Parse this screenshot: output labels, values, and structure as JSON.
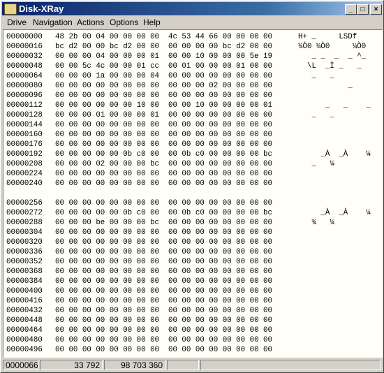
{
  "window": {
    "title": "Disk-XRay"
  },
  "menu": [
    "Drive",
    "Navigation",
    "Actions",
    "Options",
    "Help"
  ],
  "titlebar_buttons": [
    "minimize-icon",
    "maximize-icon",
    "close-icon"
  ],
  "dump": [
    {
      "offset": "00000000",
      "hex": "48 2b 00 04 00 00 00 00  4c 53 44 66 00 00 00 00",
      "ascii": "H+ _     LSDf"
    },
    {
      "offset": "00000016",
      "hex": "bc d2 00 00 bc d2 00 00  00 00 00 00 bc d2 00 00",
      "ascii": "¼Ò0 ¼Ò0     ¼Ò0"
    },
    {
      "offset": "00000032",
      "hex": "00 00 00 04 00 00 00 01  00 00 10 00 00 00 5e 19",
      "ascii": "   _ _  _  _ ^_"
    },
    {
      "offset": "00000048",
      "hex": "00 00 5c 4c 00 00 01 cc  00 01 00 00 00 01 00 00",
      "ascii": "  \\L  _Ì _   _"
    },
    {
      "offset": "00000064",
      "hex": "00 00 00 1a 00 00 00 04  00 00 00 00 00 00 00 00",
      "ascii": "   _   _"
    },
    {
      "offset": "00000080",
      "hex": "00 00 00 00 00 00 00 00  00 00 00 02 00 00 00 00",
      "ascii": "           _"
    },
    {
      "offset": "00000096",
      "hex": "00 00 00 00 00 00 00 00  00 00 00 00 00 00 00 00",
      "ascii": ""
    },
    {
      "offset": "00000112",
      "hex": "00 00 00 00 00 00 10 00  00 00 10 00 00 00 00 01",
      "ascii": "      _   _    _"
    },
    {
      "offset": "00000128",
      "hex": "00 00 00 01 00 00 00 01  00 00 00 00 00 00 00 00",
      "ascii": "   _   _"
    },
    {
      "offset": "00000144",
      "hex": "00 00 00 00 00 00 00 00  00 00 00 00 00 00 00 00",
      "ascii": ""
    },
    {
      "offset": "00000160",
      "hex": "00 00 00 00 00 00 00 00  00 00 00 00 00 00 00 00",
      "ascii": ""
    },
    {
      "offset": "00000176",
      "hex": "00 00 00 00 00 00 00 00  00 00 00 00 00 00 00 00",
      "ascii": ""
    },
    {
      "offset": "00000192",
      "hex": "00 00 00 00 00 0b c0 00  00 0b c0 00 00 00 00 bc",
      "ascii": "     _À  _À    ¼"
    },
    {
      "offset": "00000208",
      "hex": "00 00 00 02 00 00 00 bc  00 00 00 00 00 00 00 00",
      "ascii": "   _   ¼"
    },
    {
      "offset": "00000224",
      "hex": "00 00 00 00 00 00 00 00  00 00 00 00 00 00 00 00",
      "ascii": ""
    },
    {
      "offset": "00000240",
      "hex": "00 00 00 00 00 00 00 00  00 00 00 00 00 00 00 00",
      "ascii": ""
    },
    {
      "offset": "",
      "hex": "",
      "ascii": ""
    },
    {
      "offset": "00000256",
      "hex": "00 00 00 00 00 00 00 00  00 00 00 00 00 00 00 00",
      "ascii": ""
    },
    {
      "offset": "00000272",
      "hex": "00 00 00 00 00 0b c0 00  00 0b c0 00 00 00 00 bc",
      "ascii": "     _À  _À    ¼"
    },
    {
      "offset": "00000288",
      "hex": "00 00 00 be 00 00 00 bc  00 00 00 00 00 00 00 00",
      "ascii": "   ¾   ¼"
    },
    {
      "offset": "00000304",
      "hex": "00 00 00 00 00 00 00 00  00 00 00 00 00 00 00 00",
      "ascii": ""
    },
    {
      "offset": "00000320",
      "hex": "00 00 00 00 00 00 00 00  00 00 00 00 00 00 00 00",
      "ascii": ""
    },
    {
      "offset": "00000336",
      "hex": "00 00 00 00 00 00 00 00  00 00 00 00 00 00 00 00",
      "ascii": ""
    },
    {
      "offset": "00000352",
      "hex": "00 00 00 00 00 00 00 00  00 00 00 00 00 00 00 00",
      "ascii": ""
    },
    {
      "offset": "00000368",
      "hex": "00 00 00 00 00 00 00 00  00 00 00 00 00 00 00 00",
      "ascii": ""
    },
    {
      "offset": "00000384",
      "hex": "00 00 00 00 00 00 00 00  00 00 00 00 00 00 00 00",
      "ascii": ""
    },
    {
      "offset": "00000400",
      "hex": "00 00 00 00 00 00 00 00  00 00 00 00 00 00 00 00",
      "ascii": ""
    },
    {
      "offset": "00000416",
      "hex": "00 00 00 00 00 00 00 00  00 00 00 00 00 00 00 00",
      "ascii": ""
    },
    {
      "offset": "00000432",
      "hex": "00 00 00 00 00 00 00 00  00 00 00 00 00 00 00 00",
      "ascii": ""
    },
    {
      "offset": "00000448",
      "hex": "00 00 00 00 00 00 00 00  00 00 00 00 00 00 00 00",
      "ascii": ""
    },
    {
      "offset": "00000464",
      "hex": "00 00 00 00 00 00 00 00  00 00 00 00 00 00 00 00",
      "ascii": ""
    },
    {
      "offset": "00000480",
      "hex": "00 00 00 00 00 00 00 00  00 00 00 00 00 00 00 00",
      "ascii": ""
    },
    {
      "offset": "00000496",
      "hex": "00 00 00 00 00 00 00 00  00 00 00 00 00 00 00 00",
      "ascii": ""
    }
  ],
  "status": {
    "position": "0000066",
    "selected": "33 792",
    "total": "98 703 360",
    "field4": "",
    "field5": ""
  },
  "colors": {
    "title_gradient_start": "#0a246a",
    "content_bg": "#fffff7",
    "chrome": "#d4d0c8"
  }
}
